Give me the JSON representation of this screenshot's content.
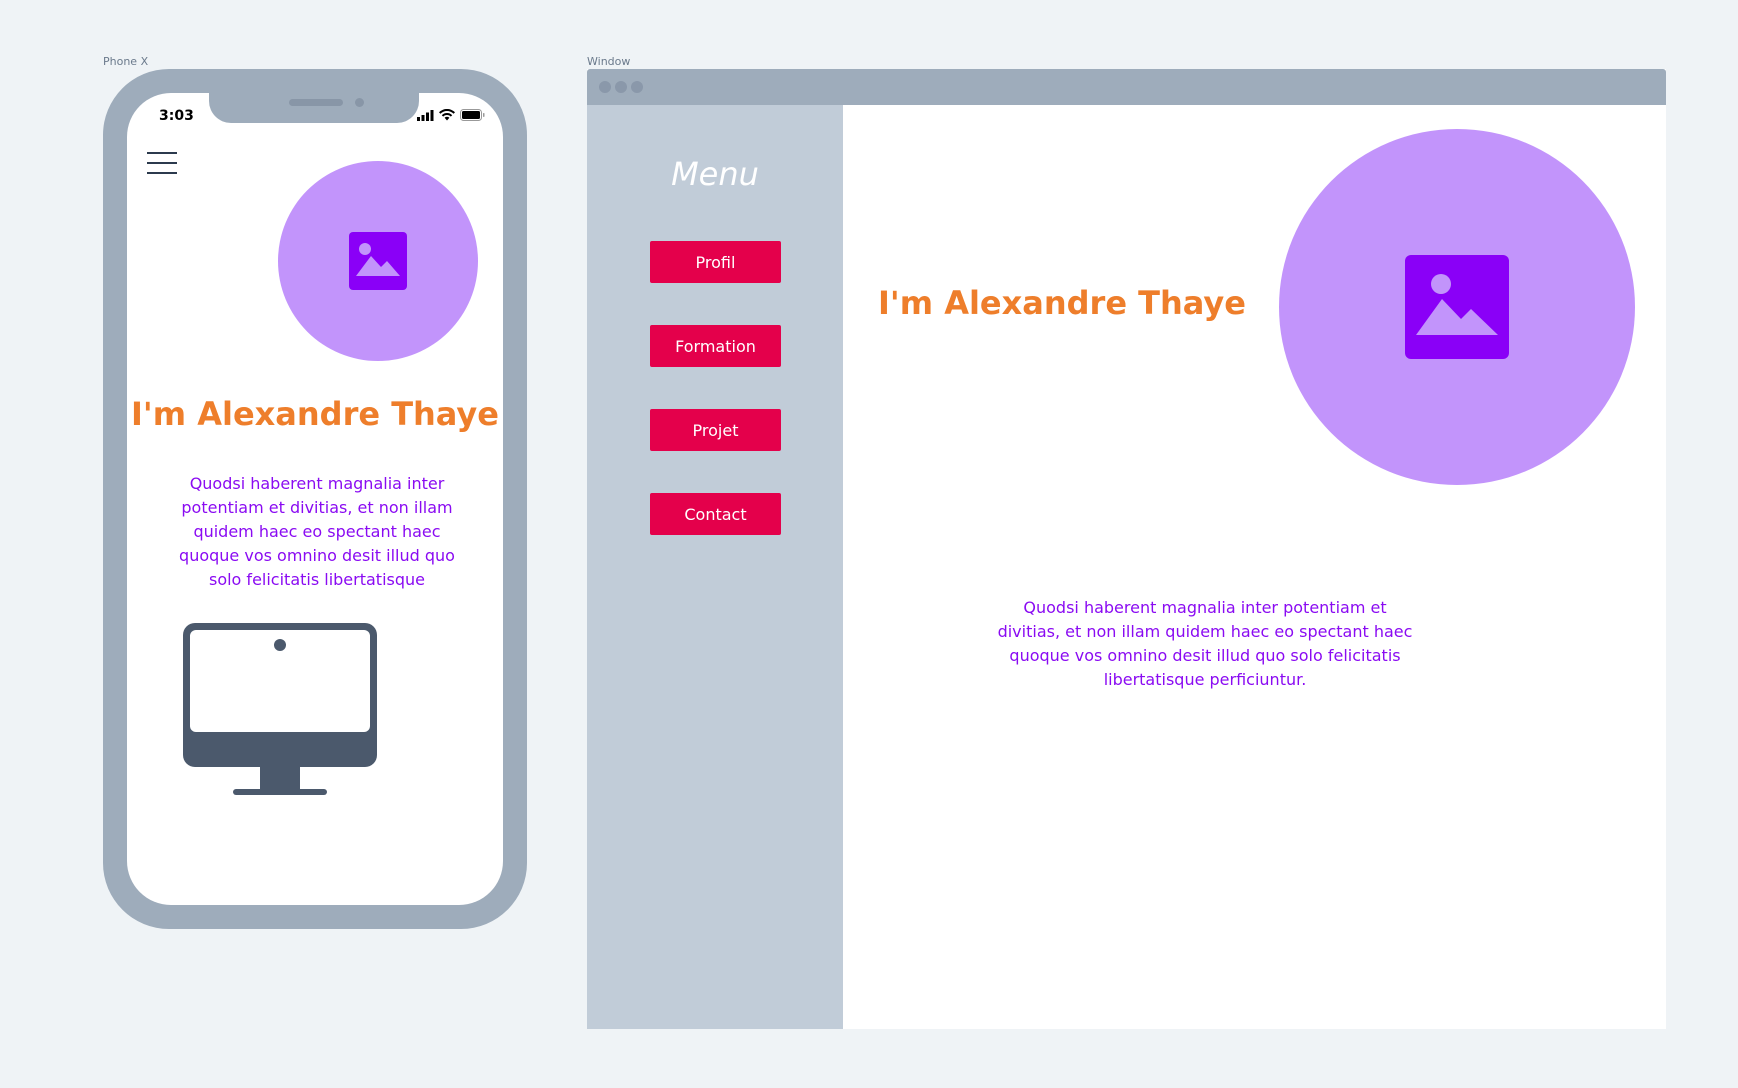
{
  "frames": {
    "phone_label": "Phone X",
    "window_label": "Window"
  },
  "phone": {
    "status": {
      "time": "3:03",
      "icons": [
        "signal-icon",
        "wifi-icon",
        "battery-icon"
      ]
    },
    "menu_icon": "hamburger-menu-icon",
    "avatar_icon": "image-placeholder-icon",
    "heading": "I'm Alexandre Thaye",
    "body": "Quodsi haberent magnalia inter potentiam et divitias, et non illam quidem haec eo spectant haec quoque vos omnino desit illud quo solo felicitatis libertatisque",
    "illustration_icon": "desktop-monitor-icon"
  },
  "window": {
    "sidebar": {
      "title": "Menu",
      "buttons": [
        {
          "label": "Profil"
        },
        {
          "label": "Formation"
        },
        {
          "label": "Projet"
        },
        {
          "label": "Contact"
        }
      ]
    },
    "heading": "I'm Alexandre Thaye",
    "avatar_icon": "image-placeholder-icon",
    "body": "Quodsi haberent magnalia inter potentiam et divitias, et non illam quidem haec eo spectant haec quoque vos omnino desit illud quo solo felicitatis libertatisque perficiuntur."
  },
  "colors": {
    "accent_orange": "#ee7e2b",
    "text_purple": "#8a0bf2",
    "avatar_lilac": "#c294fb",
    "button_red": "#e4004b",
    "frame_gray": "#9eacbb",
    "sidebar_gray": "#c1ccd8"
  }
}
